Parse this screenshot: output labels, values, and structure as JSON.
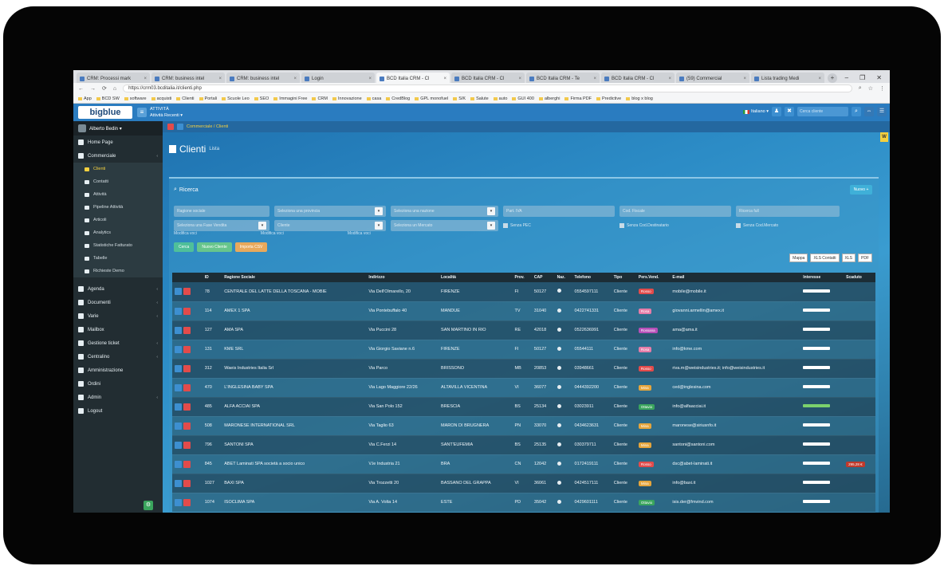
{
  "browser": {
    "tabs": [
      {
        "label": "CRM: Processi mark"
      },
      {
        "label": "CRM: business intel"
      },
      {
        "label": "CRM: business intel"
      },
      {
        "label": "Login"
      },
      {
        "label": "BCD Italia CRM - Cl",
        "active": true
      },
      {
        "label": "BCD Italia CRM - Cl"
      },
      {
        "label": "BCD Italia CRM - Te"
      },
      {
        "label": "BCD Italia CRM - Cl"
      },
      {
        "label": "(59) Commercial"
      },
      {
        "label": "Lista trading Medi"
      }
    ],
    "url": "https://crm03.bcditalia.it/clienti.php",
    "bookmarks": [
      "App",
      "BCD SW",
      "software",
      "acquisti",
      "Clienti",
      "Portali",
      "Scuole Leo",
      "SEO",
      "Immagini Free",
      "CRM",
      "Innovazione",
      "casa",
      "CredBlog",
      "GPL monofuel",
      "S/K",
      "Salute",
      "auto",
      "GUI 400",
      "alberghi",
      "Firma PDF",
      "Predictive",
      "blog x blog"
    ]
  },
  "header": {
    "logo": "bigblue",
    "recent_title": "ATTIVITÀ",
    "recent_label": "Attività Recenti ▾",
    "language": "Italiano ▾",
    "search_placeholder": "Cerca cliente"
  },
  "sidebar": {
    "user": "Alberto Bedin ▾",
    "items": [
      {
        "label": "Home Page"
      },
      {
        "label": "Commerciale"
      }
    ],
    "subitems": [
      {
        "label": "Clienti",
        "active": true
      },
      {
        "label": "Contatti"
      },
      {
        "label": "Attività"
      },
      {
        "label": "Pipeline Attività"
      },
      {
        "label": "Articoli"
      },
      {
        "label": "Analytics"
      },
      {
        "label": "Statistiche Fatturato"
      },
      {
        "label": "Tabelle"
      },
      {
        "label": "Richieste Demo"
      }
    ],
    "items2": [
      {
        "label": "Agenda"
      },
      {
        "label": "Documenti"
      },
      {
        "label": "Varie"
      },
      {
        "label": "Mailbox"
      },
      {
        "label": "Gestione ticket"
      },
      {
        "label": "Centralino"
      },
      {
        "label": "Amministrazione"
      },
      {
        "label": "Ordini"
      },
      {
        "label": "Admin"
      },
      {
        "label": "Logout"
      }
    ]
  },
  "breadcrumb": "Commerciale / Clienti",
  "page": {
    "title": "Clienti",
    "subtitle": "Lista"
  },
  "search": {
    "title": "Ricerca",
    "new_button": "Nuovo +",
    "row1": [
      {
        "placeholder": "Ragione sociale",
        "w": 120
      },
      {
        "placeholder": "Seleziona una provincia",
        "w": 140
      },
      {
        "placeholder": "Seleziona una nazione",
        "w": 135
      },
      {
        "placeholder": "Part. IVA",
        "w": 140
      },
      {
        "placeholder": "Cod. Fiscale",
        "w": 140
      },
      {
        "placeholder": "Ricerca full",
        "w": 130
      }
    ],
    "row2": [
      {
        "placeholder": "Seleziona una Fase Vendita",
        "w": 120
      },
      {
        "placeholder": "Cliente",
        "w": 140
      },
      {
        "placeholder": "Seleziona un Mercato",
        "w": 135
      }
    ],
    "checkboxes": [
      "Senza PEC",
      "Senza Cod.Destinatario",
      "Senza Cod.Mercato"
    ],
    "modifica": "Modifica voci",
    "buttons": [
      {
        "label": "Cerca",
        "color": "#4fbf9a"
      },
      {
        "label": "Nuovo Cliente",
        "color": "#67c58c"
      },
      {
        "label": "Importa CSV",
        "color": "#e8a95c"
      }
    ],
    "export": [
      "Mappa",
      "XLS Contatti",
      "XLS",
      "PDF"
    ]
  },
  "table": {
    "headers": [
      "",
      "ID",
      "Ragione Sociale",
      "Indirizzo",
      "Località",
      "Prov.",
      "CAP",
      "Naz.",
      "Telefono",
      "Tipo",
      "Pers.Vend.",
      "E-mail",
      "Interesse",
      "Scaduto"
    ],
    "rows": [
      {
        "id": "78",
        "name": "CENTRALE DEL LATTE DELLA TOSCANA - MOBIE",
        "addr": "Via Dell'Olmarello, 20",
        "city": "FIRENZE",
        "prov": "FI",
        "cap": "50127",
        "tel": "0554597111",
        "tipo": "Cliente",
        "pv": "Rosso",
        "pvc": "#e24b4b",
        "mail": "mobile@mobile.it",
        "int": "w",
        "scad": ""
      },
      {
        "id": "114",
        "name": "AMEX 1 SPA",
        "addr": "Via Pontebuffalo 40",
        "city": "MANDUE",
        "prov": "TV",
        "cap": "31040",
        "tel": "0422741331",
        "tipo": "Cliente",
        "pv": "Rosa",
        "pvc": "#e57ca8",
        "mail": "giovanni.armellin@amex.it",
        "int": "w",
        "scad": ""
      },
      {
        "id": "127",
        "name": "AMA SPA",
        "addr": "Via Puccini 28",
        "city": "SAN MARTINO IN RIO",
        "prov": "RE",
        "cap": "42018",
        "tel": "0522636991",
        "tipo": "Cliente",
        "pv": "Rossana",
        "pvc": "#b64fb8",
        "mail": "ama@ama.it",
        "int": "w",
        "scad": ""
      },
      {
        "id": "131",
        "name": "KME SRL",
        "addr": "Via Giorgio Saviane n.6",
        "city": "FIRENZE",
        "prov": "FI",
        "cap": "50127",
        "tel": "05544111",
        "tipo": "Cliente",
        "pv": "Rosa",
        "pvc": "#e57ca8",
        "mail": "info@kme.com",
        "int": "w",
        "scad": ""
      },
      {
        "id": "312",
        "name": "Waeis Industries Italia Srl",
        "addr": "Via Parco",
        "city": "BRISSONO",
        "prov": "MB",
        "cap": "20853",
        "tel": "03948661",
        "tipo": "Cliente",
        "pv": "Rosso",
        "pvc": "#e24b4b",
        "mail": "riva.m@weisindustries.it; info@weisindustries.it",
        "int": "w",
        "scad": ""
      },
      {
        "id": "470",
        "name": "L'INGLESINA BABY SPA",
        "addr": "Via Lago Maggiore 22/26",
        "city": "ALTAVILLA VICENTINA",
        "prov": "VI",
        "cap": "36077",
        "tel": "0444392200",
        "tipo": "Cliente",
        "pv": "Mina",
        "pvc": "#e5a53c",
        "mail": "ced@inglesina.com",
        "int": "w",
        "scad": ""
      },
      {
        "id": "485",
        "name": "ALFA ACCIAI SPA",
        "addr": "Via San Polo 152",
        "city": "BRESCIA",
        "prov": "BS",
        "cap": "25134",
        "tel": "03023911",
        "tipo": "Cliente",
        "pv": "Ottavio",
        "pvc": "#3aa55d",
        "mail": "info@alfaacciai.it",
        "int": "g",
        "scad": ""
      },
      {
        "id": "508",
        "name": "MARONESE INTERNATIONAL SRL",
        "addr": "Via Taglio 63",
        "city": "MARON DI BRUGNERA",
        "prov": "PN",
        "cap": "33070",
        "tel": "0434623631",
        "tipo": "Cliente",
        "pv": "Mina",
        "pvc": "#e5a53c",
        "mail": "maronese@siriusnfo.it",
        "int": "w",
        "scad": ""
      },
      {
        "id": "796",
        "name": "SANTONI SPA",
        "addr": "Via C.Ferzi 14",
        "city": "SANT'EUFEMIA",
        "prov": "BS",
        "cap": "25135",
        "tel": "030379711",
        "tipo": "Cliente",
        "pv": "Mina",
        "pvc": "#e5a53c",
        "mail": "santoni@santoni.com",
        "int": "w",
        "scad": ""
      },
      {
        "id": "845",
        "name": "ABET Laminati SPA società a socio unico",
        "addr": "V.le Industria 21",
        "city": "BRA",
        "prov": "CN",
        "cap": "12042",
        "tel": "0172419111",
        "tipo": "Cliente",
        "pv": "Rosso",
        "pvc": "#e24b4b",
        "mail": "dsc@abet-laminati.it",
        "int": "w",
        "scad": "295,28 €"
      },
      {
        "id": "1027",
        "name": "BAXI SPA",
        "addr": "Via Trozzetti 20",
        "city": "BASSANO DEL GRAPPA",
        "prov": "VI",
        "cap": "36061",
        "tel": "0424517111",
        "tipo": "Cliente",
        "pv": "Mina",
        "pvc": "#e5a53c",
        "mail": "info@baxi.it",
        "int": "w",
        "scad": ""
      },
      {
        "id": "1074",
        "name": "ISOCLIMA SPA",
        "addr": "Via A. Volta 14",
        "city": "ESTE",
        "prov": "PD",
        "cap": "35042",
        "tel": "0429601111",
        "tipo": "Cliente",
        "pv": "Ottavio",
        "pvc": "#3aa55d",
        "mail": "isis.der@fmvind.com",
        "int": "w",
        "scad": ""
      }
    ]
  }
}
